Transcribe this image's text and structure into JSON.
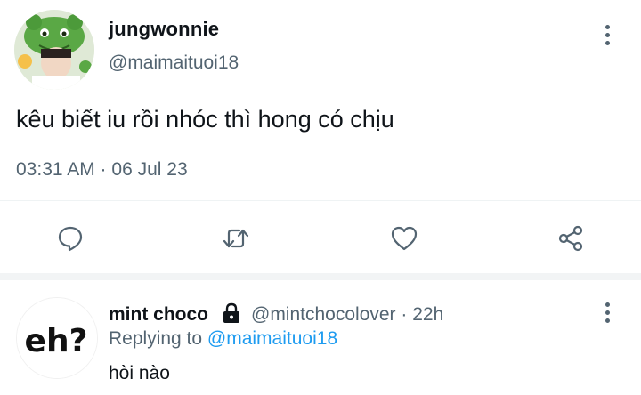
{
  "tweet": {
    "display_name": "jungwonnie",
    "handle": "@maimaituoi18",
    "text": "kêu biết iu rồi nhóc thì hong có chịu",
    "timestamp": "03:31 AM · 06 Jul 23",
    "avatar": "profile-photo-green-hat",
    "more_icon": "more-vertical-icon"
  },
  "actions": [
    {
      "name": "reply",
      "icon": "comment-icon"
    },
    {
      "name": "retweet",
      "icon": "retweet-icon"
    },
    {
      "name": "like",
      "icon": "heart-icon"
    },
    {
      "name": "share",
      "icon": "share-icon"
    }
  ],
  "reply": {
    "display_name": "mint choco",
    "protected_icon": "lock-icon",
    "handle_time": "@mintchocolover · 22h",
    "replying_prefix": "Replying to",
    "replying_to": "@maimaituoi18",
    "text": "hòi nào",
    "avatar_text": "eh?"
  },
  "colors": {
    "text": "#0f1419",
    "secondary": "#536471",
    "link": "#1d9bf0",
    "divider": "#eff3f4"
  }
}
